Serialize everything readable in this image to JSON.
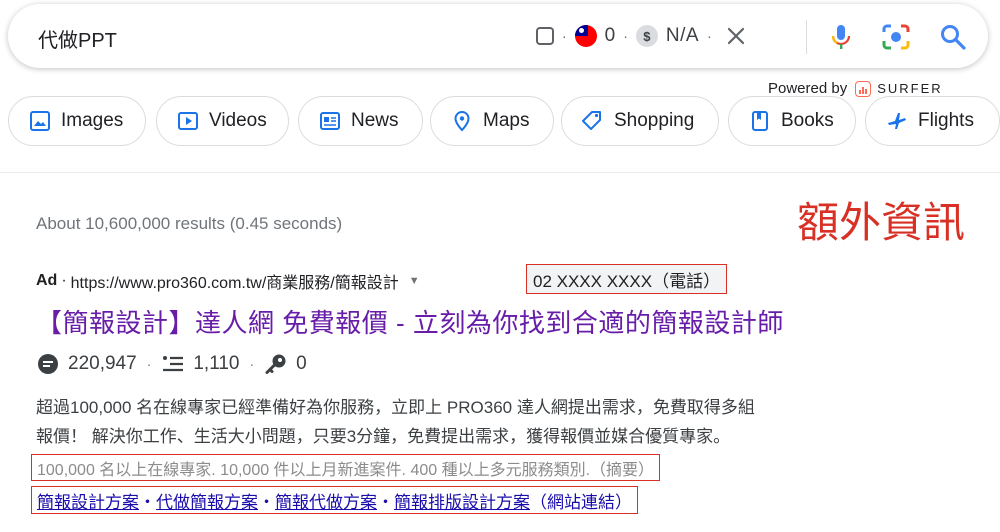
{
  "search": {
    "query": "代做PPT"
  },
  "toolbar": {
    "separator": "·",
    "flag_count": "0",
    "dollar_symbol": "$",
    "cpc_value": "N/A"
  },
  "powered_by": {
    "prefix": "Powered by",
    "brand": "SURFER",
    "brand_color": "#ff6b57"
  },
  "chips": [
    {
      "label": "Images",
      "icon": "image-icon"
    },
    {
      "label": "Videos",
      "icon": "play-icon"
    },
    {
      "label": "News",
      "icon": "news-icon"
    },
    {
      "label": "Maps",
      "icon": "map-pin-icon"
    },
    {
      "label": "Shopping",
      "icon": "tag-icon"
    },
    {
      "label": "Books",
      "icon": "book-icon"
    },
    {
      "label": "Flights",
      "icon": "plane-icon"
    }
  ],
  "results": {
    "stats": "About 10,600,000 results (0.45 seconds)",
    "annotation_extra": "額外資訊",
    "annotation_color": "#d93025"
  },
  "ad": {
    "label": "Ad",
    "bullet": "·",
    "url": "https://www.pro360.com.tw/商業服務/簡報設計",
    "phone": "02 XXXX XXXX（電話）",
    "title": "【簡報設計】達人網 免費報價 - 立刻為你找到合適的簡報設計師",
    "title_color": "#681da8",
    "metrics": {
      "reviews": "220,947",
      "listings": "1,110",
      "keys": "0"
    },
    "description_line1": "超過100,000 名在線專家已經準備好為你服務，立即上 PRO360 達人網提出需求，免費取得多組",
    "description_line2": "報價！ 解決你工作、生活大小問題，只要3分鐘，免費提出需求，獲得報價並媒合優質專家。",
    "summary": "100,000 名以上在線專家. 10,000 件以上月新進案件. 400 種以上多元服務類別.（摘要）",
    "sitelinks": [
      "簡報設計方案",
      "代做簡報方案",
      "簡報代做方案",
      "簡報排版設計方案"
    ],
    "sitelinks_suffix": "（網站連結）",
    "sitelink_sep": "・"
  }
}
